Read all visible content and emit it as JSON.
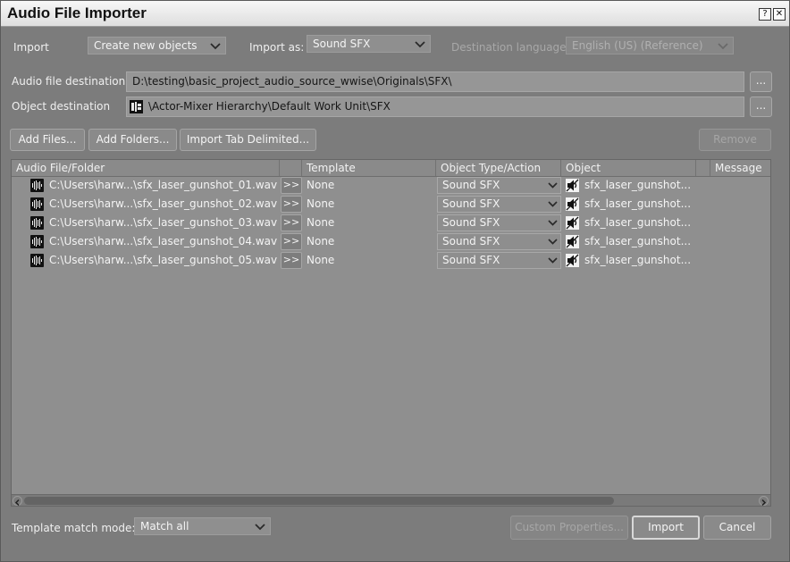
{
  "window": {
    "title": "Audio File Importer",
    "help_glyph": "?",
    "close_glyph": "✕"
  },
  "import_row": {
    "import_label": "Import",
    "import_value": "Create new objects",
    "import_as_label": "Import as:",
    "import_as_value": "Sound SFX",
    "dest_lang_label": "Destination language:",
    "dest_lang_value": "English (US) (Reference)"
  },
  "paths": {
    "audio_dest_label": "Audio file destination",
    "audio_dest_value": "D:\\testing\\basic_project_audio_source_wwise\\Originals\\SFX\\",
    "object_dest_label": "Object destination",
    "object_dest_value": "\\Actor-Mixer Hierarchy\\Default Work Unit\\SFX",
    "browse_label": "..."
  },
  "actions": {
    "add_files": "Add Files...",
    "add_folders": "Add Folders...",
    "import_tab": "Import Tab Delimited...",
    "remove": "Remove"
  },
  "list": {
    "columns": [
      "Audio File/Folder",
      "Template",
      "Object Type/Action",
      "Object",
      "Message"
    ],
    "rows": [
      {
        "file": "C:\\Users\\harw...\\sfx_laser_gunshot_01.wav",
        "btn": ">>",
        "template": "None",
        "type": "Sound SFX",
        "object": "sfx_laser_gunshot..."
      },
      {
        "file": "C:\\Users\\harw...\\sfx_laser_gunshot_02.wav",
        "btn": ">>",
        "template": "None",
        "type": "Sound SFX",
        "object": "sfx_laser_gunshot..."
      },
      {
        "file": "C:\\Users\\harw...\\sfx_laser_gunshot_03.wav",
        "btn": ">>",
        "template": "None",
        "type": "Sound SFX",
        "object": "sfx_laser_gunshot..."
      },
      {
        "file": "C:\\Users\\harw...\\sfx_laser_gunshot_04.wav",
        "btn": ">>",
        "template": "None",
        "type": "Sound SFX",
        "object": "sfx_laser_gunshot..."
      },
      {
        "file": "C:\\Users\\harw...\\sfx_laser_gunshot_05.wav",
        "btn": ">>",
        "template": "None",
        "type": "Sound SFX",
        "object": "sfx_laser_gunshot..."
      }
    ]
  },
  "footer": {
    "match_label": "Template match mode:",
    "match_value": "Match all",
    "custom_props": "Custom Properties...",
    "import": "Import",
    "cancel": "Cancel"
  },
  "icons": {
    "wav": "audio-file-icon",
    "sfx": "sound-sfx-icon",
    "work_unit": "work-unit-icon",
    "dropdown": "chevron-down-icon"
  }
}
